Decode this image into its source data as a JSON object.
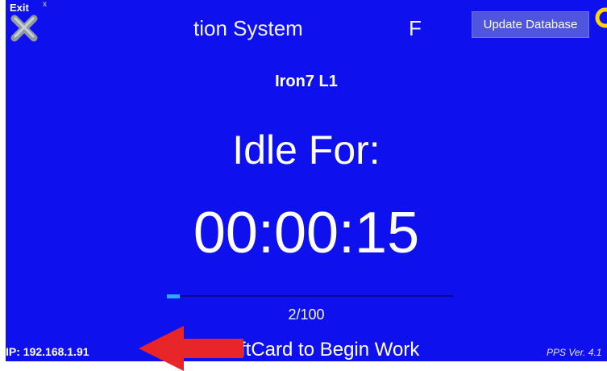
{
  "header": {
    "exit_label": "Exit",
    "exit_small": "x",
    "title_partial": "tion System",
    "title_right_partial": "F",
    "update_button": "Update Database",
    "refresh_icon": "refresh-icon"
  },
  "station": {
    "name": "Iron7 L1"
  },
  "status": {
    "label": "Idle For:",
    "timer": "00:00:15"
  },
  "progress": {
    "count_text": "2/100",
    "fraction": 0.02
  },
  "footer": {
    "ip": "IP: 192.168.1.91",
    "instruction_partial": "ftCard to Begin Work",
    "version_partial": "PPS Ver. 4.1"
  },
  "annotation": {
    "arrow_color": "#e8262a",
    "arrow_icon": "left-arrow-icon"
  },
  "colors": {
    "background": "#0f10ee",
    "button": "#4f55df",
    "progress_fill": "#35a7ff",
    "refresh_icon": "#ffd400"
  }
}
